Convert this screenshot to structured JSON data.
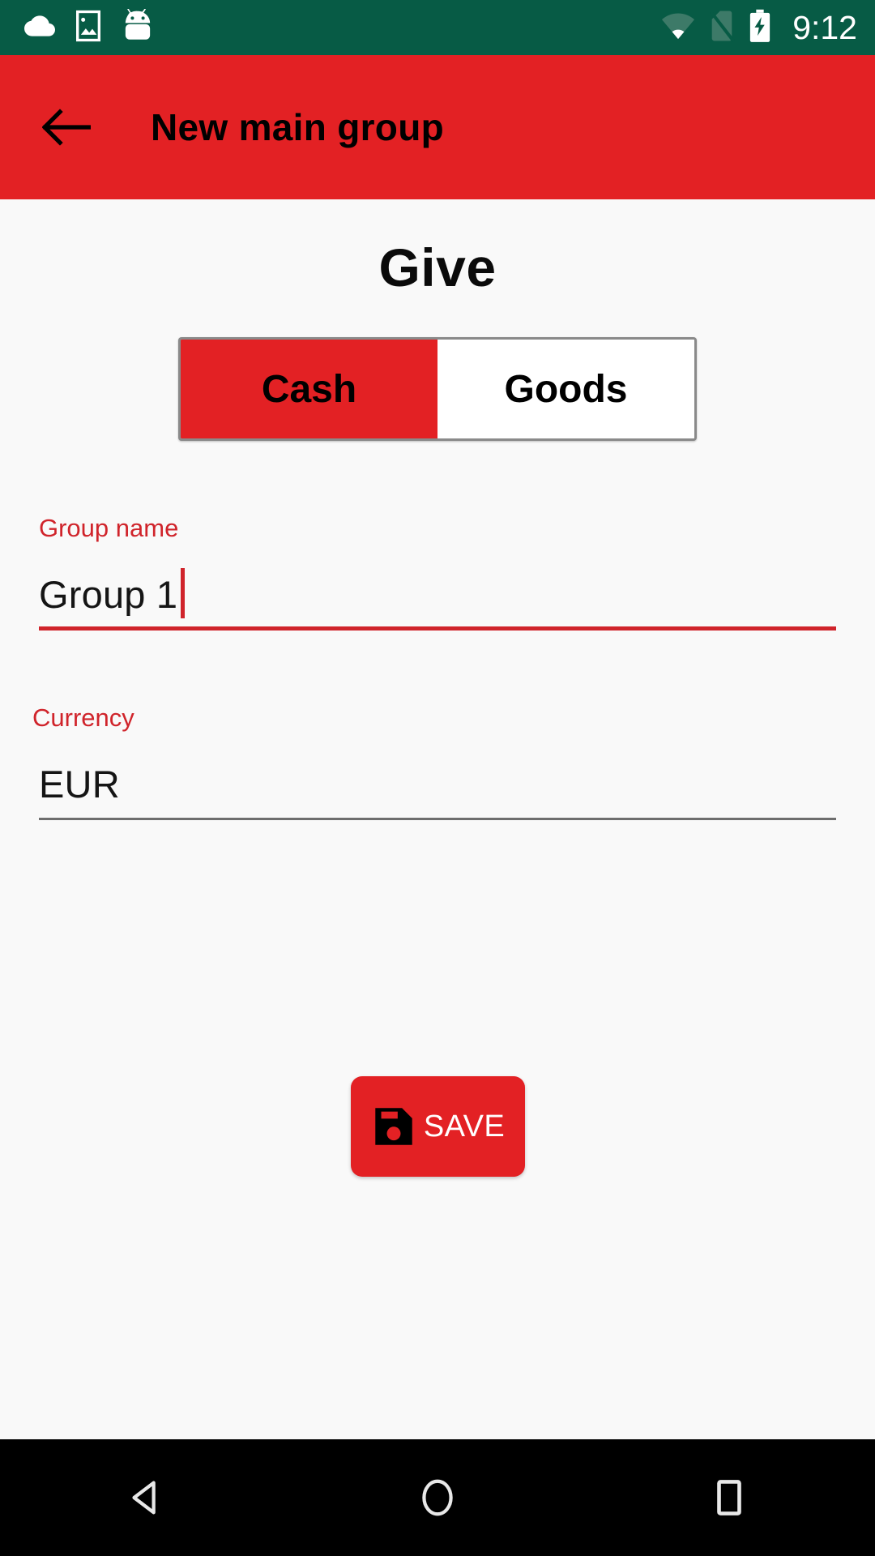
{
  "status_bar": {
    "background_color": "#075b45",
    "time": "9:12",
    "left_icons": [
      {
        "name": "cloud-icon",
        "label": "cloud"
      },
      {
        "name": "screenshot-image-icon",
        "label": "screenshot"
      },
      {
        "name": "android-mascot-icon",
        "label": "android"
      }
    ],
    "right_icons": [
      {
        "name": "wifi-icon",
        "label": "wifi"
      },
      {
        "name": "no-sim-icon",
        "label": "no sim"
      },
      {
        "name": "battery-charging-icon",
        "label": "battery charging"
      }
    ]
  },
  "app_bar": {
    "background_color": "#e32124",
    "back_label": "Back",
    "title": "New main group"
  },
  "main": {
    "heading": "Give",
    "toggle": {
      "selected": "Cash",
      "options": [
        {
          "label": "Cash",
          "selected": true
        },
        {
          "label": "Goods",
          "selected": false
        }
      ]
    },
    "fields": [
      {
        "label": "Group name",
        "value": "Group 1",
        "placeholder": "Group name",
        "focused": true
      },
      {
        "label": "Currency",
        "value": "EUR",
        "placeholder": "Currency",
        "focused": false
      }
    ],
    "save_button": {
      "label": "SAVE",
      "icon": "floppy-disk-save-icon",
      "background_color": "#e32124"
    }
  },
  "nav_bar": {
    "background_color": "#000000",
    "buttons": [
      {
        "name": "nav-back-button",
        "label": "Back"
      },
      {
        "name": "nav-home-button",
        "label": "Home"
      },
      {
        "name": "nav-recents-button",
        "label": "Recents"
      }
    ]
  },
  "colors": {
    "accent_red": "#e32124",
    "label_red": "#d0242b",
    "status_green": "#075b45",
    "page_background": "#f9f9f9"
  }
}
